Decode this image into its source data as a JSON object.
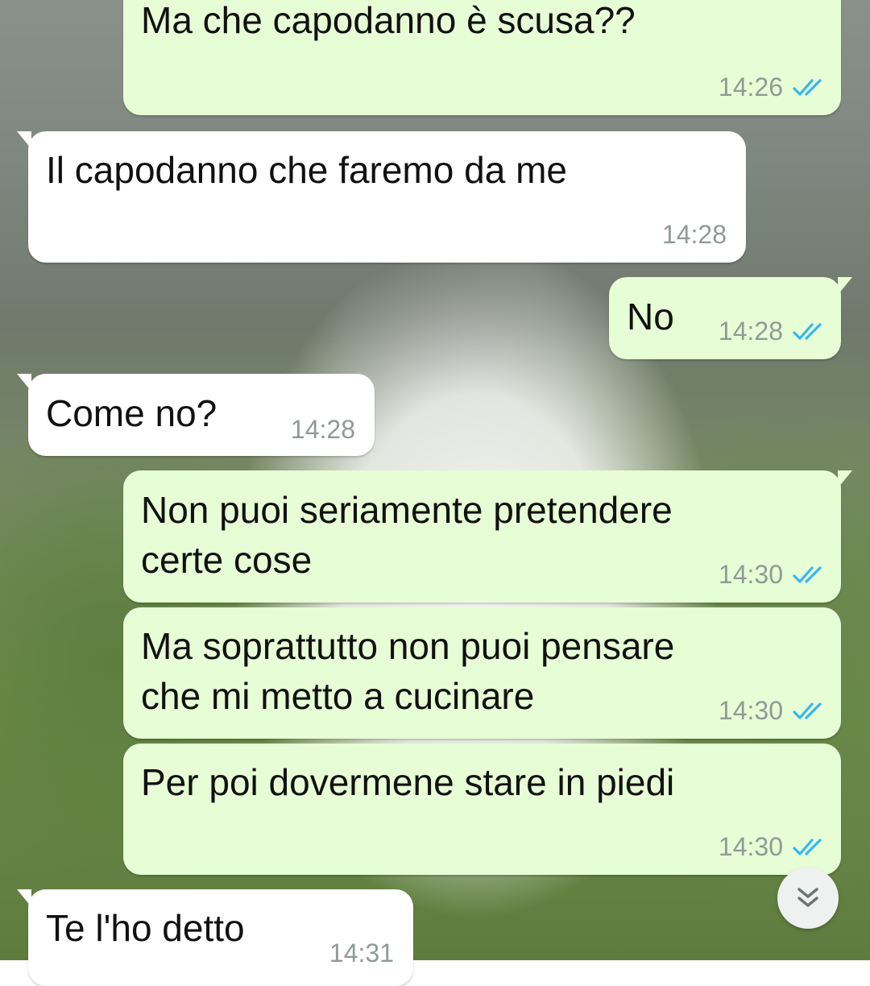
{
  "icons": {
    "read_receipt": "double-check-icon",
    "scroll_down": "chevron-double-down-icon"
  },
  "colors": {
    "outgoing_bubble": "#e7fdd6",
    "incoming_bubble": "#ffffff",
    "read_tick": "#34b7f1",
    "timestamp": "#8f9b94"
  },
  "messages": [
    {
      "direction": "outgoing",
      "text": "Ma che capodanno è scusa??",
      "time": "14:26",
      "read": true
    },
    {
      "direction": "incoming",
      "text": "Il capodanno che faremo da me",
      "time": "14:28"
    },
    {
      "direction": "outgoing",
      "text": "No",
      "time": "14:28",
      "read": true
    },
    {
      "direction": "incoming",
      "text": "Come no?",
      "time": "14:28"
    },
    {
      "direction": "outgoing",
      "text": "Non puoi seriamente pretendere\ncerte cose",
      "time": "14:30",
      "read": true
    },
    {
      "direction": "outgoing",
      "text": "Ma soprattutto non puoi pensare\nche mi metto a cucinare",
      "time": "14:30",
      "read": true
    },
    {
      "direction": "outgoing",
      "text": "Per poi dovermene stare in piedi",
      "time": "14:30",
      "read": true
    },
    {
      "direction": "incoming",
      "text": "Te l'ho detto",
      "time": "14:31"
    }
  ]
}
